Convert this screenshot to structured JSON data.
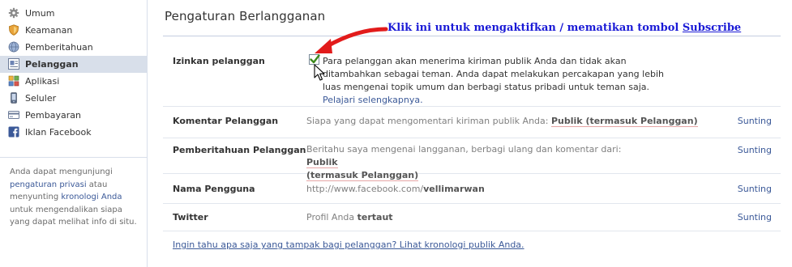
{
  "sidebar": {
    "items": [
      {
        "label": "Umum",
        "icon": "gear-icon"
      },
      {
        "label": "Keamanan",
        "icon": "shield-icon"
      },
      {
        "label": "Pemberitahuan",
        "icon": "globe-icon"
      },
      {
        "label": "Pelanggan",
        "icon": "subscribers-icon",
        "active": true
      },
      {
        "label": "Aplikasi",
        "icon": "apps-icon"
      },
      {
        "label": "Seluler",
        "icon": "mobile-icon"
      },
      {
        "label": "Pembayaran",
        "icon": "credit-card-icon"
      },
      {
        "label": "Iklan Facebook",
        "icon": "facebook-icon"
      }
    ],
    "note": {
      "text1": "Anda dapat mengunjungi ",
      "link1": "pengaturan privasi",
      "text2": " atau menyunting ",
      "link2": "kronologi Anda",
      "text3": " untuk mengendalikan siapa yang dapat melihat info di situ."
    }
  },
  "page": {
    "title": "Pengaturan Berlangganan"
  },
  "annotation": {
    "text": "Klik ini untuk mengaktifkan / mematikan tombol ",
    "highlight": "Subscribe",
    "color": "#1a1ad6",
    "arrow_color": "#e21b1b"
  },
  "settings": {
    "allow": {
      "label": "Izinkan pelanggan",
      "checked": true,
      "description": "Para pelanggan akan menerima kiriman publik Anda dan tidak akan ditambahkan sebagai teman. Anda dapat melakukan percakapan yang lebih luas mengenai topik umum dan berbagi status pribadi untuk teman saja. ",
      "link": "Pelajari selengkapnya."
    },
    "comments": {
      "label": "Komentar Pelanggan",
      "text": "Siapa yang dapat mengomentari kiriman publik Anda: ",
      "value": "Publik (termasuk Pelanggan)",
      "edit": "Sunting"
    },
    "notifications": {
      "label": "Pemberitahuan Pelanggan",
      "text": "Beritahu saya mengenai langganan, berbagi ulang dan komentar dari: ",
      "value_a": "Publik",
      "value_b": "(termasuk Pelanggan)",
      "edit": "Sunting"
    },
    "username": {
      "label": "Nama Pengguna",
      "prefix": "http://www.facebook.com/",
      "value": "vellimarwan",
      "edit": "Sunting"
    },
    "twitter": {
      "label": "Twitter",
      "text": "Profil Anda ",
      "value": "tertaut",
      "edit": "Sunting"
    }
  },
  "footer": {
    "link": "Ingin tahu apa saja yang tampak bagi pelanggan? Lihat kronologi publik Anda."
  },
  "colors": {
    "link": "#3b5998",
    "active_bg": "#d8dfea",
    "check": "#3c8a1c"
  }
}
